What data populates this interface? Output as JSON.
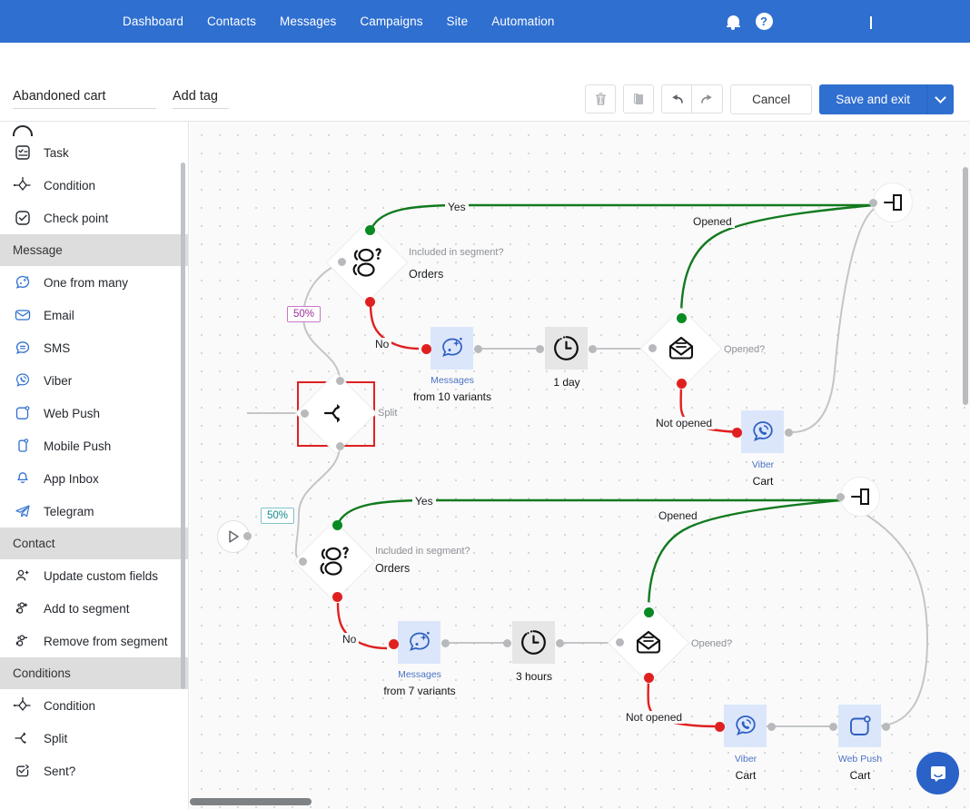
{
  "navbar": {
    "links": [
      {
        "label": "Dashboard"
      },
      {
        "label": "Contacts"
      },
      {
        "label": "Messages"
      },
      {
        "label": "Campaigns"
      },
      {
        "label": "Site"
      },
      {
        "label": "Automation"
      }
    ],
    "bell_icon": "bell-icon",
    "help_icon": "help-question-icon",
    "account_caret_icon": "chevron-down-icon",
    "bg_color": "#2f6fd0"
  },
  "toolbar": {
    "workflow_name": "Abandoned cart",
    "tag_value": "Add tag",
    "delete_icon": "trash-icon",
    "copy_icon": "copy-icon",
    "undo_icon": "undo-arrow-icon",
    "redo_icon": "redo-arrow-icon",
    "cancel_label": "Cancel",
    "save_label": "Save and exit",
    "save_caret_icon": "chevron-down-icon",
    "save_color": "#2f6fd0"
  },
  "sidebar": {
    "sections": [
      {
        "title": null,
        "items": [
          {
            "label": "Task",
            "icon": "task-checklist-icon"
          },
          {
            "label": "Condition",
            "icon": "condition-diamond-icon"
          },
          {
            "label": "Check point",
            "icon": "check-point-icon"
          }
        ]
      },
      {
        "title": "Message",
        "items": [
          {
            "label": "One from many",
            "icon": "one-from-many-icon"
          },
          {
            "label": "Email",
            "icon": "email-icon"
          },
          {
            "label": "SMS",
            "icon": "sms-icon"
          },
          {
            "label": "Viber",
            "icon": "viber-icon"
          },
          {
            "label": "Web Push",
            "icon": "web-push-icon"
          },
          {
            "label": "Mobile Push",
            "icon": "mobile-push-icon"
          },
          {
            "label": "App Inbox",
            "icon": "app-inbox-bell-icon"
          },
          {
            "label": "Telegram",
            "icon": "telegram-icon"
          }
        ]
      },
      {
        "title": "Contact",
        "items": [
          {
            "label": "Update custom fields",
            "icon": "update-custom-fields-icon"
          },
          {
            "label": "Add to segment",
            "icon": "add-to-segment-icon"
          },
          {
            "label": "Remove from segment",
            "icon": "remove-from-segment-icon"
          }
        ]
      },
      {
        "title": "Conditions",
        "items": [
          {
            "label": "Condition",
            "icon": "condition-diamond-icon"
          },
          {
            "label": "Split",
            "icon": "split-icon"
          },
          {
            "label": "Sent?",
            "icon": "sent-icon"
          }
        ]
      }
    ]
  },
  "canvas": {
    "nodes": {
      "start": {
        "icon": "play-start-icon"
      },
      "split": {
        "label": "Split",
        "icon": "split-icon",
        "selected": true,
        "selection_color": "#e02020"
      },
      "branch_top": {
        "percent": "50%",
        "percent_color": "#9c2f9c",
        "segment_question": "Included in segment?",
        "segment_name": "Orders",
        "yes_label": "Yes",
        "no_label": "No",
        "message_title": "Messages",
        "message_sub": "from 10 variants",
        "delay_label": "1 day",
        "opened_question": "Opened?",
        "opened_label": "Opened",
        "not_opened_label": "Not opened",
        "viber_title": "Viber",
        "viber_sub": "Cart"
      },
      "branch_bottom": {
        "percent": "50%",
        "percent_color": "#11888f",
        "segment_question": "Included in segment?",
        "segment_name": "Orders",
        "yes_label": "Yes",
        "no_label": "No",
        "message_title": "Messages",
        "message_sub": "from 7 variants",
        "delay_label": "3 hours",
        "opened_question": "Opened?",
        "opened_label": "Opened",
        "not_opened_label": "Not opened",
        "viber_title": "Viber",
        "viber_sub": "Cart",
        "webpush_title": "Web Push",
        "webpush_sub": "Cart"
      },
      "exit_top": {
        "icon": "exit-door-icon"
      },
      "exit_bottom": {
        "icon": "exit-door-icon"
      }
    }
  },
  "chat": {
    "icon": "intercom-chat-icon",
    "color": "#2a62c8"
  }
}
